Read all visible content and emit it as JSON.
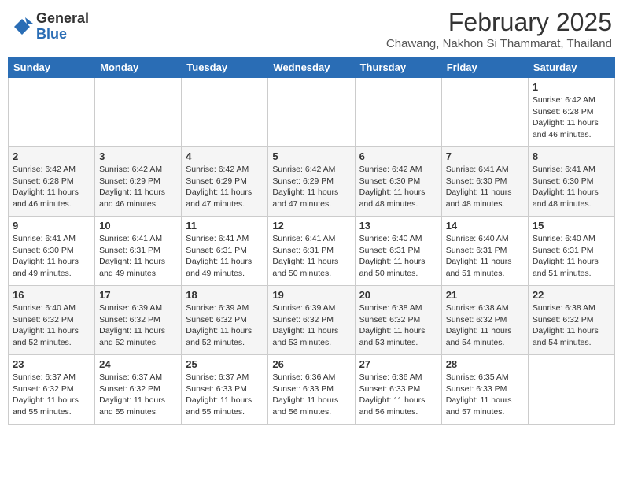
{
  "header": {
    "logo": {
      "general": "General",
      "blue": "Blue"
    },
    "title": "February 2025",
    "location": "Chawang, Nakhon Si Thammarat, Thailand"
  },
  "weekdays": [
    "Sunday",
    "Monday",
    "Tuesday",
    "Wednesday",
    "Thursday",
    "Friday",
    "Saturday"
  ],
  "weeks": [
    [
      {
        "day": "",
        "info": ""
      },
      {
        "day": "",
        "info": ""
      },
      {
        "day": "",
        "info": ""
      },
      {
        "day": "",
        "info": ""
      },
      {
        "day": "",
        "info": ""
      },
      {
        "day": "",
        "info": ""
      },
      {
        "day": "1",
        "info": "Sunrise: 6:42 AM\nSunset: 6:28 PM\nDaylight: 11 hours\nand 46 minutes."
      }
    ],
    [
      {
        "day": "2",
        "info": "Sunrise: 6:42 AM\nSunset: 6:28 PM\nDaylight: 11 hours\nand 46 minutes."
      },
      {
        "day": "3",
        "info": "Sunrise: 6:42 AM\nSunset: 6:29 PM\nDaylight: 11 hours\nand 46 minutes."
      },
      {
        "day": "4",
        "info": "Sunrise: 6:42 AM\nSunset: 6:29 PM\nDaylight: 11 hours\nand 47 minutes."
      },
      {
        "day": "5",
        "info": "Sunrise: 6:42 AM\nSunset: 6:29 PM\nDaylight: 11 hours\nand 47 minutes."
      },
      {
        "day": "6",
        "info": "Sunrise: 6:42 AM\nSunset: 6:30 PM\nDaylight: 11 hours\nand 48 minutes."
      },
      {
        "day": "7",
        "info": "Sunrise: 6:41 AM\nSunset: 6:30 PM\nDaylight: 11 hours\nand 48 minutes."
      },
      {
        "day": "8",
        "info": "Sunrise: 6:41 AM\nSunset: 6:30 PM\nDaylight: 11 hours\nand 48 minutes."
      }
    ],
    [
      {
        "day": "9",
        "info": "Sunrise: 6:41 AM\nSunset: 6:30 PM\nDaylight: 11 hours\nand 49 minutes."
      },
      {
        "day": "10",
        "info": "Sunrise: 6:41 AM\nSunset: 6:31 PM\nDaylight: 11 hours\nand 49 minutes."
      },
      {
        "day": "11",
        "info": "Sunrise: 6:41 AM\nSunset: 6:31 PM\nDaylight: 11 hours\nand 49 minutes."
      },
      {
        "day": "12",
        "info": "Sunrise: 6:41 AM\nSunset: 6:31 PM\nDaylight: 11 hours\nand 50 minutes."
      },
      {
        "day": "13",
        "info": "Sunrise: 6:40 AM\nSunset: 6:31 PM\nDaylight: 11 hours\nand 50 minutes."
      },
      {
        "day": "14",
        "info": "Sunrise: 6:40 AM\nSunset: 6:31 PM\nDaylight: 11 hours\nand 51 minutes."
      },
      {
        "day": "15",
        "info": "Sunrise: 6:40 AM\nSunset: 6:31 PM\nDaylight: 11 hours\nand 51 minutes."
      }
    ],
    [
      {
        "day": "16",
        "info": "Sunrise: 6:40 AM\nSunset: 6:32 PM\nDaylight: 11 hours\nand 52 minutes."
      },
      {
        "day": "17",
        "info": "Sunrise: 6:39 AM\nSunset: 6:32 PM\nDaylight: 11 hours\nand 52 minutes."
      },
      {
        "day": "18",
        "info": "Sunrise: 6:39 AM\nSunset: 6:32 PM\nDaylight: 11 hours\nand 52 minutes."
      },
      {
        "day": "19",
        "info": "Sunrise: 6:39 AM\nSunset: 6:32 PM\nDaylight: 11 hours\nand 53 minutes."
      },
      {
        "day": "20",
        "info": "Sunrise: 6:38 AM\nSunset: 6:32 PM\nDaylight: 11 hours\nand 53 minutes."
      },
      {
        "day": "21",
        "info": "Sunrise: 6:38 AM\nSunset: 6:32 PM\nDaylight: 11 hours\nand 54 minutes."
      },
      {
        "day": "22",
        "info": "Sunrise: 6:38 AM\nSunset: 6:32 PM\nDaylight: 11 hours\nand 54 minutes."
      }
    ],
    [
      {
        "day": "23",
        "info": "Sunrise: 6:37 AM\nSunset: 6:32 PM\nDaylight: 11 hours\nand 55 minutes."
      },
      {
        "day": "24",
        "info": "Sunrise: 6:37 AM\nSunset: 6:32 PM\nDaylight: 11 hours\nand 55 minutes."
      },
      {
        "day": "25",
        "info": "Sunrise: 6:37 AM\nSunset: 6:33 PM\nDaylight: 11 hours\nand 55 minutes."
      },
      {
        "day": "26",
        "info": "Sunrise: 6:36 AM\nSunset: 6:33 PM\nDaylight: 11 hours\nand 56 minutes."
      },
      {
        "day": "27",
        "info": "Sunrise: 6:36 AM\nSunset: 6:33 PM\nDaylight: 11 hours\nand 56 minutes."
      },
      {
        "day": "28",
        "info": "Sunrise: 6:35 AM\nSunset: 6:33 PM\nDaylight: 11 hours\nand 57 minutes."
      },
      {
        "day": "",
        "info": ""
      }
    ]
  ]
}
